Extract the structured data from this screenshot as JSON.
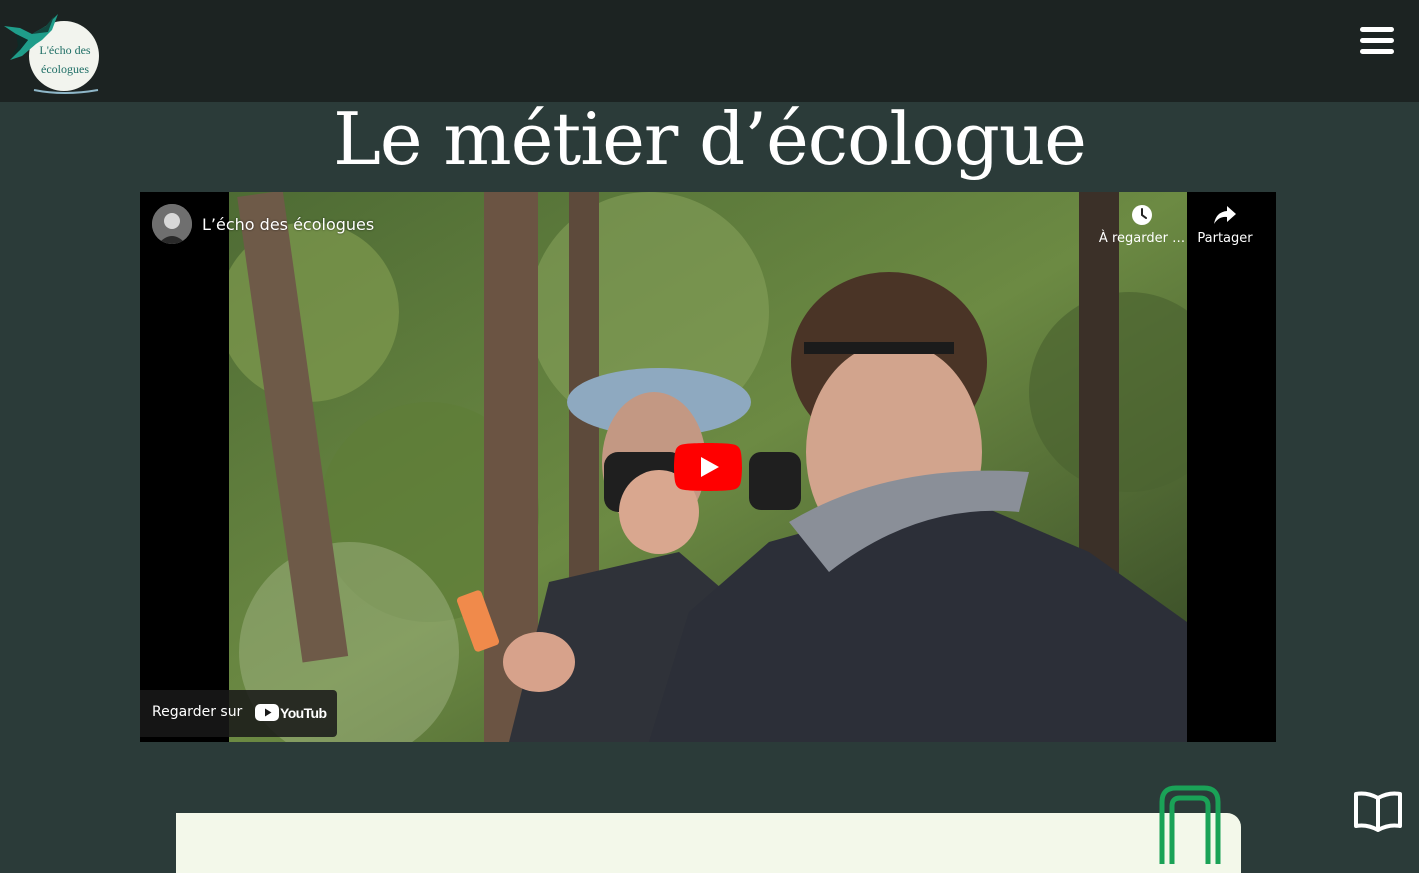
{
  "header": {
    "logo": {
      "text_line1": "L'écho des",
      "text_line2": "écologues",
      "alt": "L'écho des écologues"
    },
    "menu_icon": "hamburger-menu-icon"
  },
  "main": {
    "title": "Le métier d’écologue"
  },
  "video": {
    "channel_name": "L’écho des écologues",
    "watch_later_label": "À regarder …",
    "share_label": "Partager",
    "watch_on_label": "Regarder sur",
    "platform_logo_text": "YouTube",
    "icons": {
      "watch_later": "clock-icon",
      "share": "share-arrow-icon",
      "play": "play-icon"
    }
  },
  "footer": {
    "book_icon": "open-book-icon",
    "clip_icon": "paper-clip-icon"
  },
  "colors": {
    "header_bg": "#1c2322",
    "page_bg": "#2b3b39",
    "card_bg": "#f3f8ea",
    "clip_green": "#1aa257",
    "youtube_red": "#ff0000",
    "logo_bird": "#1f9d8a"
  }
}
